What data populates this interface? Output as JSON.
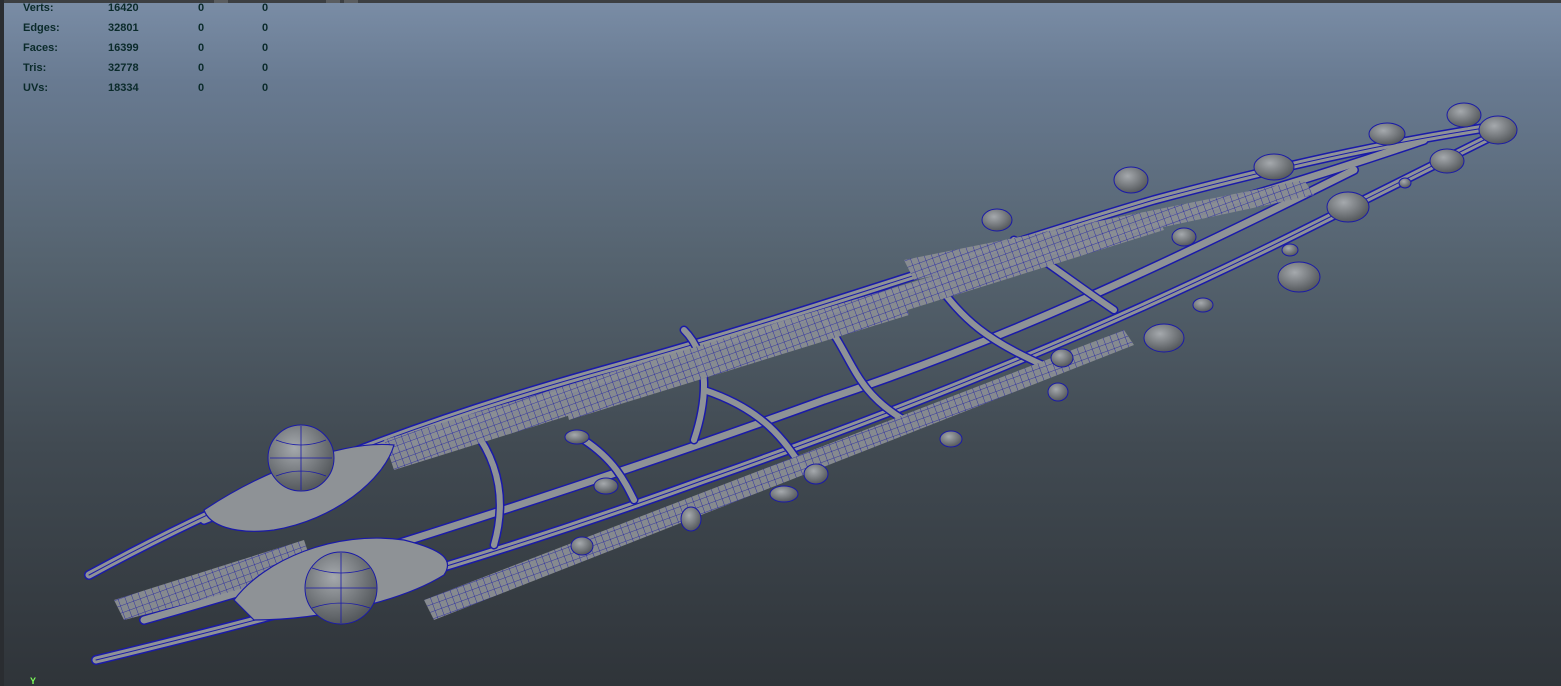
{
  "hud": {
    "rows": [
      {
        "label": "Verts:",
        "total": "16420",
        "selected": "0",
        "components": "0"
      },
      {
        "label": "Edges:",
        "total": "32801",
        "selected": "0",
        "components": "0"
      },
      {
        "label": "Faces:",
        "total": "16399",
        "selected": "0",
        "components": "0"
      },
      {
        "label": "Tris:",
        "total": "32778",
        "selected": "0",
        "components": "0"
      },
      {
        "label": "UVs:",
        "total": "18334",
        "selected": "0",
        "components": "0"
      }
    ]
  },
  "axis": {
    "label": "Y"
  },
  "colors": {
    "mesh_fill": "#8e9296",
    "wire": "#1a1aa8",
    "hud_text": "#0a2a2a",
    "axis_text": "#7dff5a"
  },
  "icons": [
    "axis-indicator"
  ]
}
